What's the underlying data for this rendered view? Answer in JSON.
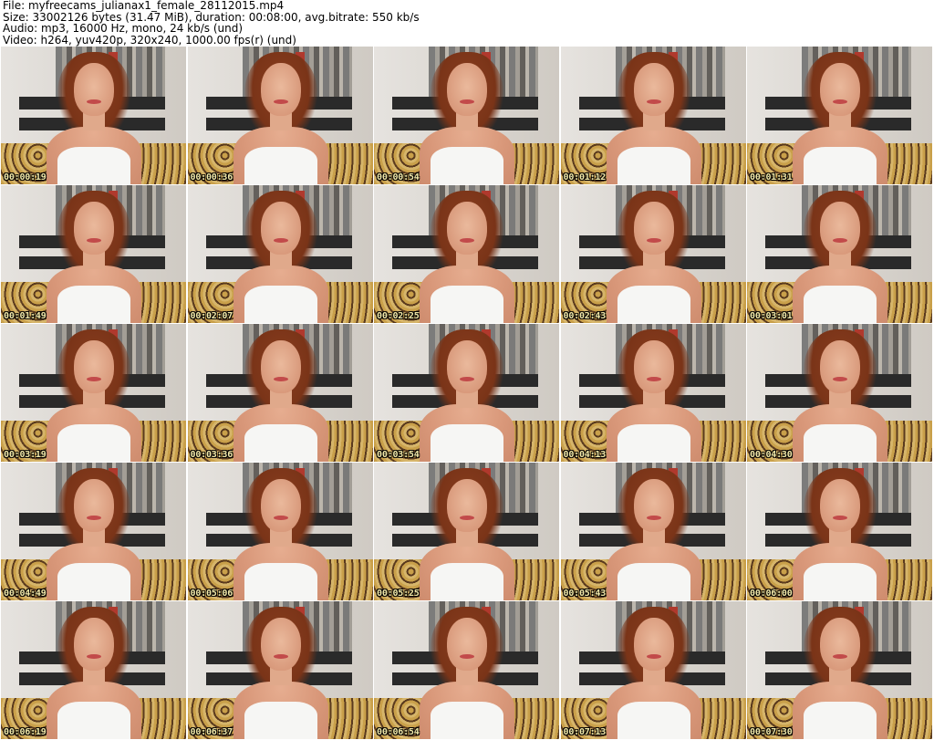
{
  "header": {
    "file_line": "File: myfreecams_julianax1_female_28112015.mp4",
    "size_line": "Size: 33002126 bytes (31.47 MiB), duration: 00:08:00, avg.bitrate: 550 kb/s",
    "audio_line": "Audio: mp3, 16000 Hz, mono, 24 kb/s (und)",
    "video_line": "Video: h264, yuv420p, 320x240, 1000.00 fps(r) (und)"
  },
  "frames": [
    {
      "timestamp": "00:00:19"
    },
    {
      "timestamp": "00:00:36"
    },
    {
      "timestamp": "00:00:54"
    },
    {
      "timestamp": "00:01:12"
    },
    {
      "timestamp": "00:01:31"
    },
    {
      "timestamp": "00:01:49"
    },
    {
      "timestamp": "00:02:07"
    },
    {
      "timestamp": "00:02:25"
    },
    {
      "timestamp": "00:02:43"
    },
    {
      "timestamp": "00:03:01"
    },
    {
      "timestamp": "00:03:19"
    },
    {
      "timestamp": "00:03:36"
    },
    {
      "timestamp": "00:03:54"
    },
    {
      "timestamp": "00:04:13"
    },
    {
      "timestamp": "00:04:30"
    },
    {
      "timestamp": "00:04:49"
    },
    {
      "timestamp": "00:05:06"
    },
    {
      "timestamp": "00:05:25"
    },
    {
      "timestamp": "00:05:43"
    },
    {
      "timestamp": "00:06:00"
    },
    {
      "timestamp": "00:06:19"
    },
    {
      "timestamp": "00:06:37"
    },
    {
      "timestamp": "00:06:54"
    },
    {
      "timestamp": "00:07:13"
    },
    {
      "timestamp": "00:07:30"
    }
  ]
}
